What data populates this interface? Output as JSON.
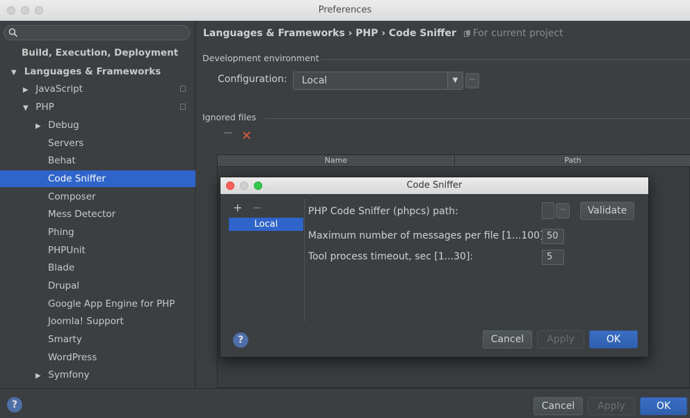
{
  "window": {
    "title": "Preferences"
  },
  "search": {
    "placeholder": ""
  },
  "sidebar": {
    "items": [
      {
        "label": "Build, Execution, Deployment"
      },
      {
        "label": "Languages & Frameworks",
        "arrow": "▼"
      },
      {
        "label": "JavaScript",
        "arrow": "▶"
      },
      {
        "label": "PHP",
        "arrow": "▼"
      },
      {
        "label": "Debug",
        "arrow": "▶"
      },
      {
        "label": "Servers"
      },
      {
        "label": "Behat"
      },
      {
        "label": "Code Sniffer"
      },
      {
        "label": "Composer"
      },
      {
        "label": "Mess Detector"
      },
      {
        "label": "Phing"
      },
      {
        "label": "PHPUnit"
      },
      {
        "label": "Blade"
      },
      {
        "label": "Drupal"
      },
      {
        "label": "Google App Engine for PHP"
      },
      {
        "label": "Joomla! Support"
      },
      {
        "label": "Smarty"
      },
      {
        "label": "WordPress"
      },
      {
        "label": "Symfony",
        "arrow": "▶"
      }
    ]
  },
  "main": {
    "breadcrumb": "Languages & Frameworks › PHP › Code Sniffer",
    "scope": "For current project",
    "dev_env_header": "Development environment",
    "configuration_label": "Configuration:",
    "configuration_value": "Local",
    "ignored_files_header": "Ignored files",
    "table_columns": [
      "Name",
      "Path"
    ]
  },
  "footer": {
    "cancel": "Cancel",
    "apply": "Apply",
    "ok": "OK",
    "help": "?"
  },
  "dialog": {
    "title": "Code Sniffer",
    "add": "+",
    "remove": "−",
    "list": [
      "Local"
    ],
    "phpcs_path_label": "PHP Code Sniffer (phpcs) path:",
    "phpcs_path_value": "",
    "validate": "Validate",
    "max_messages_label": "Maximum number of messages per file [1...100]:",
    "max_messages_value": "50",
    "timeout_label": "Tool process timeout, sec [1...30]:",
    "timeout_value": "5",
    "cancel": "Cancel",
    "apply": "Apply",
    "ok": "OK",
    "help": "?",
    "dots": "···"
  },
  "colors": {
    "selection": "#2f65ca",
    "background": "#3c3f41",
    "error_x": "#e05a3d"
  },
  "icons": [
    "search-icon",
    "copy-scope-icon",
    "remove-icon",
    "help-icon"
  ]
}
